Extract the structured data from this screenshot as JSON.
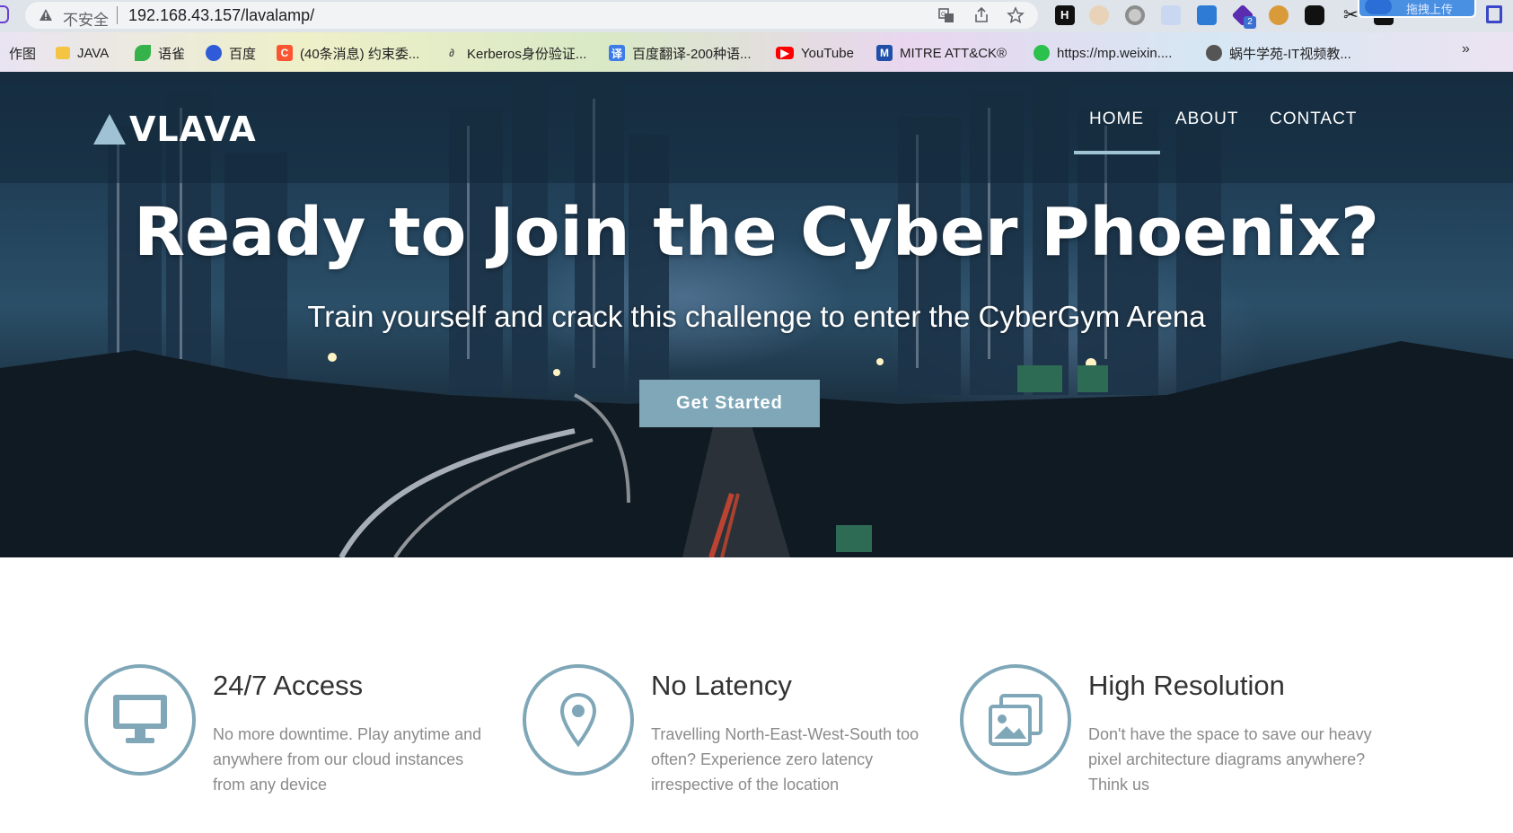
{
  "browser": {
    "security_label": "不安全",
    "url": "192.168.43.157/lavalamp/",
    "upload_extension_label": "拖拽上传",
    "ext_badge_count": "2"
  },
  "bookmarks": [
    {
      "label": "作图",
      "icon": "none",
      "color": ""
    },
    {
      "label": "JAVA",
      "icon": "folder-icon",
      "color": "#f4c542"
    },
    {
      "label": "语雀",
      "icon": "yuque-icon",
      "color": "#35b34a"
    },
    {
      "label": "百度",
      "icon": "baidu-icon",
      "color": "#2f5bd8"
    },
    {
      "label": "(40条消息) 约束委...",
      "icon": "csdn-icon",
      "color": "#fc5531"
    },
    {
      "label": "Kerberos身份验证...",
      "icon": "kerberos-icon",
      "color": "#555555"
    },
    {
      "label": "百度翻译-200种语...",
      "icon": "baidu-translate-icon",
      "color": "#3d7ce8"
    },
    {
      "label": "YouTube",
      "icon": "youtube-icon",
      "color": "#ff0000"
    },
    {
      "label": "MITRE ATT&CK®",
      "icon": "mitre-icon",
      "color": "#1f4fa8"
    },
    {
      "label": "https://mp.weixin....",
      "icon": "wechat-icon",
      "color": "#2ac14c"
    },
    {
      "label": "蜗牛学苑-IT视频教...",
      "icon": "snail-icon",
      "color": "#555555"
    }
  ],
  "site": {
    "logo_text": "VLAVA",
    "nav": {
      "home": "HOME",
      "about": "ABOUT",
      "contact": "CONTACT",
      "active": "home"
    },
    "hero": {
      "title": "Ready to Join the Cyber Phoenix?",
      "subtitle": "Train yourself and crack this challenge to enter the CyberGym Arena",
      "cta": "Get Started"
    },
    "accent_color": "#7fa7b8",
    "features": [
      {
        "icon": "monitor-icon",
        "title": "24/7 Access",
        "text": "No more downtime. Play anytime and anywhere from our cloud instances from any device"
      },
      {
        "icon": "map-pin-icon",
        "title": "No Latency",
        "text": "Travelling North-East-West-South too often? Experience zero latency irrespective of the location"
      },
      {
        "icon": "images-icon",
        "title": "High Resolution",
        "text": "Don't have the space to save our heavy pixel architecture diagrams anywhere? Think us"
      }
    ]
  }
}
